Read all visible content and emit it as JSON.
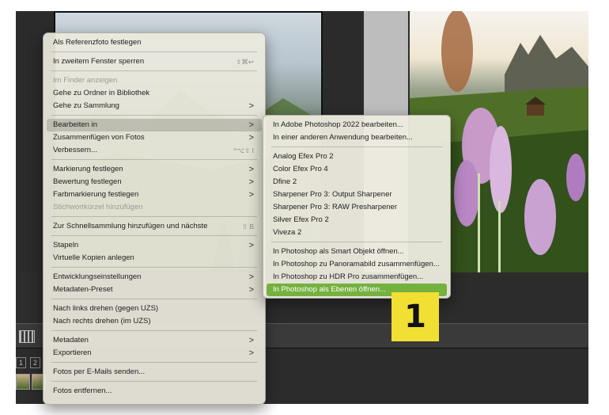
{
  "menu": {
    "items": [
      {
        "label": "Als Referenzfoto festlegen",
        "shortcut": "",
        "submenu": false,
        "disabled": false
      },
      {
        "label": "In zweitem Fenster sperren",
        "shortcut": "⇧⌘↩",
        "submenu": false,
        "disabled": false
      },
      {
        "label": "Im Finder anzeigen",
        "shortcut": "",
        "submenu": false,
        "disabled": true
      },
      {
        "label": "Gehe zu Ordner in Bibliothek",
        "shortcut": "",
        "submenu": false,
        "disabled": false
      },
      {
        "label": "Gehe zu Sammlung",
        "shortcut": "",
        "submenu": true,
        "disabled": false
      },
      {
        "label": "Bearbeiten in",
        "shortcut": "",
        "submenu": true,
        "disabled": false,
        "active": true
      },
      {
        "label": "Zusammenfügen von Fotos",
        "shortcut": "",
        "submenu": true,
        "disabled": false
      },
      {
        "label": "Verbessern...",
        "shortcut": "^⌥⇧ I",
        "submenu": false,
        "disabled": false
      },
      {
        "label": "Markierung festlegen",
        "shortcut": "",
        "submenu": true,
        "disabled": false
      },
      {
        "label": "Bewertung festlegen",
        "shortcut": "",
        "submenu": true,
        "disabled": false
      },
      {
        "label": "Farbmarkierung festlegen",
        "shortcut": "",
        "submenu": true,
        "disabled": false
      },
      {
        "label": "Stichwortkürzel hinzufügen",
        "shortcut": "",
        "submenu": false,
        "disabled": true
      },
      {
        "label": "Zur Schnellsammlung hinzufügen und nächste",
        "shortcut": "⇧ B",
        "submenu": false,
        "disabled": false
      },
      {
        "label": "Stapeln",
        "shortcut": "",
        "submenu": true,
        "disabled": false
      },
      {
        "label": "Virtuelle Kopien anlegen",
        "shortcut": "",
        "submenu": false,
        "disabled": false
      },
      {
        "label": "Entwicklungseinstellungen",
        "shortcut": "",
        "submenu": true,
        "disabled": false
      },
      {
        "label": "Metadaten-Preset",
        "shortcut": "",
        "submenu": true,
        "disabled": false
      },
      {
        "label": "Nach links drehen (gegen UZS)",
        "shortcut": "",
        "submenu": false,
        "disabled": false
      },
      {
        "label": "Nach rechts drehen (im UZS)",
        "shortcut": "",
        "submenu": false,
        "disabled": false
      },
      {
        "label": "Metadaten",
        "shortcut": "",
        "submenu": true,
        "disabled": false
      },
      {
        "label": "Exportieren",
        "shortcut": "",
        "submenu": true,
        "disabled": false
      },
      {
        "label": "Fotos per E-Mails senden...",
        "shortcut": "",
        "submenu": false,
        "disabled": false
      },
      {
        "label": "Fotos entfernen...",
        "shortcut": "",
        "submenu": false,
        "disabled": false
      }
    ]
  },
  "submenu": {
    "items": [
      {
        "label": "In Adobe Photoshop 2022 bearbeiten..."
      },
      {
        "label": "In einer anderen Anwendung bearbeiten..."
      },
      {
        "label": "Analog Efex Pro 2"
      },
      {
        "label": "Color Efex Pro 4"
      },
      {
        "label": "Dfine 2"
      },
      {
        "label": "Sharpener Pro 3: Output Sharpener"
      },
      {
        "label": "Sharpener Pro 3: RAW Presharpener"
      },
      {
        "label": "Silver Efex Pro 2"
      },
      {
        "label": "Viveza 2"
      },
      {
        "label": "In Photoshop als Smart Objekt öffnen..."
      },
      {
        "label": "In Photoshop zu Panoramabild zusammenfügen..."
      },
      {
        "label": "In Photoshop zu HDR Pro zusammenfügen..."
      },
      {
        "label": "In Photoshop als Ebenen öffnen...",
        "highlighted": true
      }
    ]
  },
  "submenu_arrow": ">",
  "filmstrip": {
    "page_numbers": [
      "1",
      "2"
    ]
  },
  "callout": {
    "number": "1"
  },
  "colors": {
    "highlight": "#74b13f",
    "callout": "#f1e033"
  }
}
